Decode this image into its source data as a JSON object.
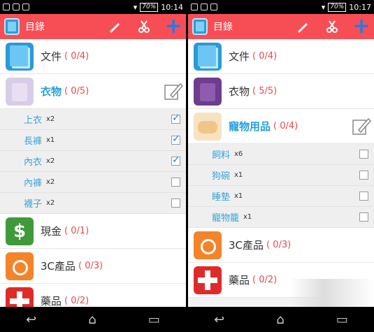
{
  "status": {
    "left_time": "10:14",
    "right_time": "10:17",
    "battery": "70%"
  },
  "toolbar": {
    "title": "目錄"
  },
  "left": {
    "categories": [
      {
        "name": "文件",
        "count": "( 0/4)"
      },
      {
        "name": "衣物",
        "count": "( 0/5)"
      },
      {
        "name": "現金",
        "count": "( 0/1)"
      },
      {
        "name": "3C產品",
        "count": "( 0/3)"
      },
      {
        "name": "藥品",
        "count": "( 0/2)"
      }
    ],
    "items": [
      {
        "name": "上衣",
        "qty": "x2",
        "checked": true
      },
      {
        "name": "長褲",
        "qty": "x1",
        "checked": true
      },
      {
        "name": "內衣",
        "qty": "x2",
        "checked": true
      },
      {
        "name": "內褲",
        "qty": "x2",
        "checked": false
      },
      {
        "name": "襪子",
        "qty": "x2",
        "checked": false
      }
    ]
  },
  "right": {
    "categories": [
      {
        "name": "文件",
        "count": "( 0/4)"
      },
      {
        "name": "衣物",
        "count": "( 5/5)"
      },
      {
        "name": "寵物用品",
        "count": "( 0/4)"
      },
      {
        "name": "3C產品",
        "count": "( 0/3)"
      },
      {
        "name": "藥品",
        "count": "( 0/2)"
      }
    ],
    "items": [
      {
        "name": "飼料",
        "qty": "x6",
        "checked": false
      },
      {
        "name": "狗碗",
        "qty": "x1",
        "checked": false
      },
      {
        "name": "睡墊",
        "qty": "x1",
        "checked": false
      },
      {
        "name": "寵物籠",
        "qty": "x1",
        "checked": false
      }
    ]
  },
  "colors": {
    "accent": "#f74e55",
    "link": "#28a0d8",
    "count": "#e64850"
  },
  "icons": [
    "documents-icon",
    "shirt-icon",
    "pet-food-icon",
    "money-icon",
    "camera-icon",
    "medicine-icon",
    "edit-icon",
    "pencil-icon",
    "scissors-icon",
    "plus-icon"
  ]
}
